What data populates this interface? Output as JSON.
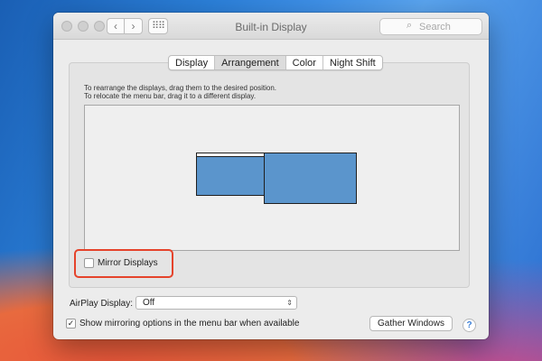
{
  "window": {
    "title": "Built-in Display"
  },
  "search": {
    "placeholder": "Search",
    "icon": "search-icon"
  },
  "nav": {
    "back": "‹",
    "forward": "›",
    "grid": "⠿⠿"
  },
  "tabs": [
    "Display",
    "Arrangement",
    "Color",
    "Night Shift"
  ],
  "active_tab": "Arrangement",
  "arrangement": {
    "instruction_line1": "To rearrange the displays, drag them to the desired position.",
    "instruction_line2": "To relocate the menu bar, drag it to a different display."
  },
  "mirror_displays": {
    "label": "Mirror Displays",
    "checked": false
  },
  "airplay": {
    "label": "AirPlay Display:",
    "value": "Off",
    "arrows": "⇕"
  },
  "show_mirroring": {
    "label": "Show mirroring options in the menu bar when available",
    "checked": true,
    "mark": "✓"
  },
  "gather_button": "Gather Windows",
  "help_button": "?",
  "colors": {
    "display_blue": "#5b95cc",
    "highlight_red": "#e5432b"
  }
}
